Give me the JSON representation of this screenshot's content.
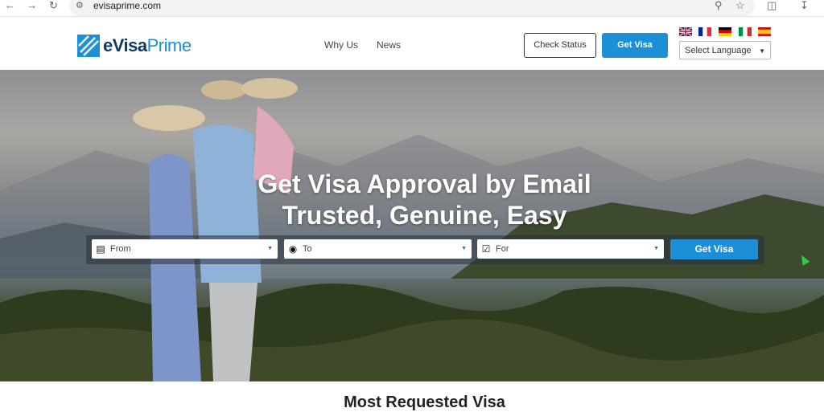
{
  "browser": {
    "url": "evisaprime.com",
    "back_icon": "back-arrow-icon",
    "forward_icon": "forward-arrow-icon",
    "reload_icon": "reload-icon"
  },
  "header": {
    "logo_main": "eVisa",
    "logo_accent": "Prime",
    "nav": [
      "Why Us",
      "News"
    ],
    "check_status": "Check Status",
    "get_visa": "Get Visa",
    "language_select": "Select Language",
    "flags": [
      "uk-flag",
      "france-flag",
      "germany-flag",
      "italy-flag",
      "spain-flag"
    ]
  },
  "hero": {
    "title_line1": "Get Visa Approval by Email",
    "title_line2": "Trusted, Genuine, Easy",
    "from_placeholder": "From",
    "to_placeholder": "To",
    "for_placeholder": "For",
    "search_button": "Get Visa"
  },
  "section": {
    "title": "Most Requested Visa"
  },
  "colors": {
    "brand_blue": "#1d8fd6",
    "logo_dark": "#0d3b66"
  }
}
